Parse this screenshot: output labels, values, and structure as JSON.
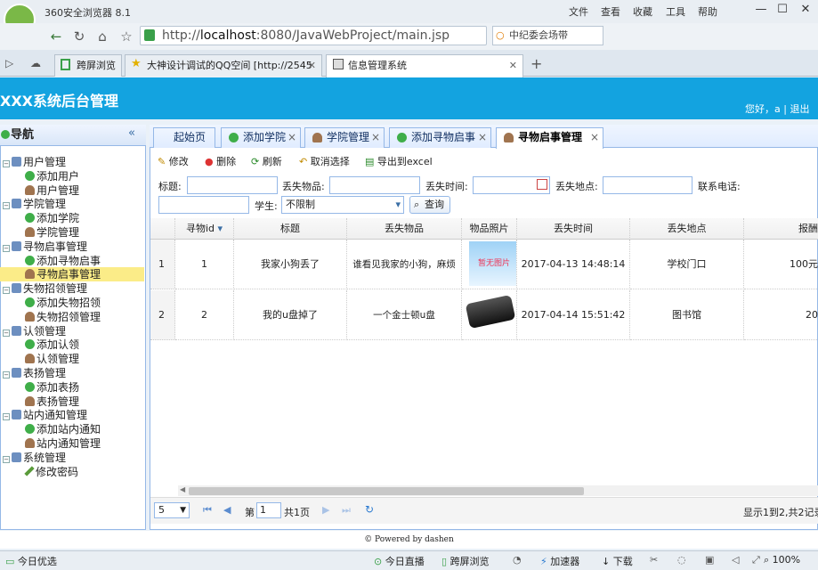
{
  "browser": {
    "name": "360安全浏览器 8.1",
    "menus": [
      "文件",
      "查看",
      "收藏",
      "工具",
      "帮助"
    ],
    "url_prefix": "http://",
    "url_host": "localhost",
    ":8080/JavaWebProject/main.jsp": "",
    "url_rest": ":8080/JavaWebProject/main.jsp",
    "search": "中纪委会场带",
    "tabs": [
      "跨屏浏览",
      "大神设计调试的QQ空间 [http://2545",
      "信息管理系统"
    ]
  },
  "app": {
    "title": "XXX系统后台管理",
    "greeting": "您好，a | 退出"
  },
  "nav": {
    "title": "导航",
    "items": [
      {
        "label": "用户管理",
        "level": 0
      },
      {
        "label": "添加用户",
        "level": 1,
        "icon": "add"
      },
      {
        "label": "用户管理",
        "level": 1,
        "icon": "user"
      },
      {
        "label": "学院管理",
        "level": 0
      },
      {
        "label": "添加学院",
        "level": 1,
        "icon": "add"
      },
      {
        "label": "学院管理",
        "level": 1,
        "icon": "user"
      },
      {
        "label": "寻物启事管理",
        "level": 0
      },
      {
        "label": "添加寻物启事",
        "level": 1,
        "icon": "add"
      },
      {
        "label": "寻物启事管理",
        "level": 1,
        "icon": "user",
        "selected": true
      },
      {
        "label": "失物招领管理",
        "level": 0
      },
      {
        "label": "添加失物招领",
        "level": 1,
        "icon": "add"
      },
      {
        "label": "失物招领管理",
        "level": 1,
        "icon": "user"
      },
      {
        "label": "认领管理",
        "level": 0
      },
      {
        "label": "添加认领",
        "level": 1,
        "icon": "add"
      },
      {
        "label": "认领管理",
        "level": 1,
        "icon": "user"
      },
      {
        "label": "表扬管理",
        "level": 0
      },
      {
        "label": "添加表扬",
        "level": 1,
        "icon": "add"
      },
      {
        "label": "表扬管理",
        "level": 1,
        "icon": "user"
      },
      {
        "label": "站内通知管理",
        "level": 0
      },
      {
        "label": "添加站内通知",
        "level": 1,
        "icon": "add"
      },
      {
        "label": "站内通知管理",
        "level": 1,
        "icon": "user"
      },
      {
        "label": "系统管理",
        "level": 0
      },
      {
        "label": "修改密码",
        "level": 1,
        "icon": "pen"
      }
    ]
  },
  "tabs": [
    "起始页",
    "添加学院",
    "学院管理",
    "添加寻物启事",
    "寻物启事管理"
  ],
  "toolbar": {
    "edit": "修改",
    "delete": "删除",
    "refresh": "刷新",
    "cancel": "取消选择",
    "export": "导出到excel"
  },
  "filters": {
    "title": "标题:",
    "lost_item": "丢失物品:",
    "lost_time": "丢失时间:",
    "lost_place": "丢失地点:",
    "phone": "联系电话:",
    "student": "学生:",
    "student_value": "不限制",
    "query": "查询"
  },
  "grid": {
    "columns": [
      "寻物id",
      "标题",
      "丢失物品",
      "物品照片",
      "丢失时间",
      "丢失地点",
      "报酬"
    ],
    "rows": [
      {
        "n": "1",
        "id": "1",
        "title": "我家小狗丢了",
        "item": "谁看见我家的小狗，麻烦",
        "photo": "暂无图片",
        "time": "2017-04-13 14:48:14",
        "place": "学校门口",
        "reward": "100元"
      },
      {
        "n": "2",
        "id": "2",
        "title": "我的u盘掉了",
        "item": "一个金士顿u盘",
        "photo": "",
        "time": "2017-04-14 15:51:42",
        "place": "图书馆",
        "reward": "20"
      }
    ]
  },
  "pager": {
    "size": "5",
    "page_prefix": "第",
    "page": "1",
    "page_suffix": "共1页",
    "info": "显示1到2,共2记录"
  },
  "footer": "© Powered by dashen",
  "status": {
    "left": "今日优选",
    "live": "今日直播",
    "cross": "跨屏浏览",
    "accel": "加速器",
    "download": "下载",
    "zoom": "100%"
  }
}
